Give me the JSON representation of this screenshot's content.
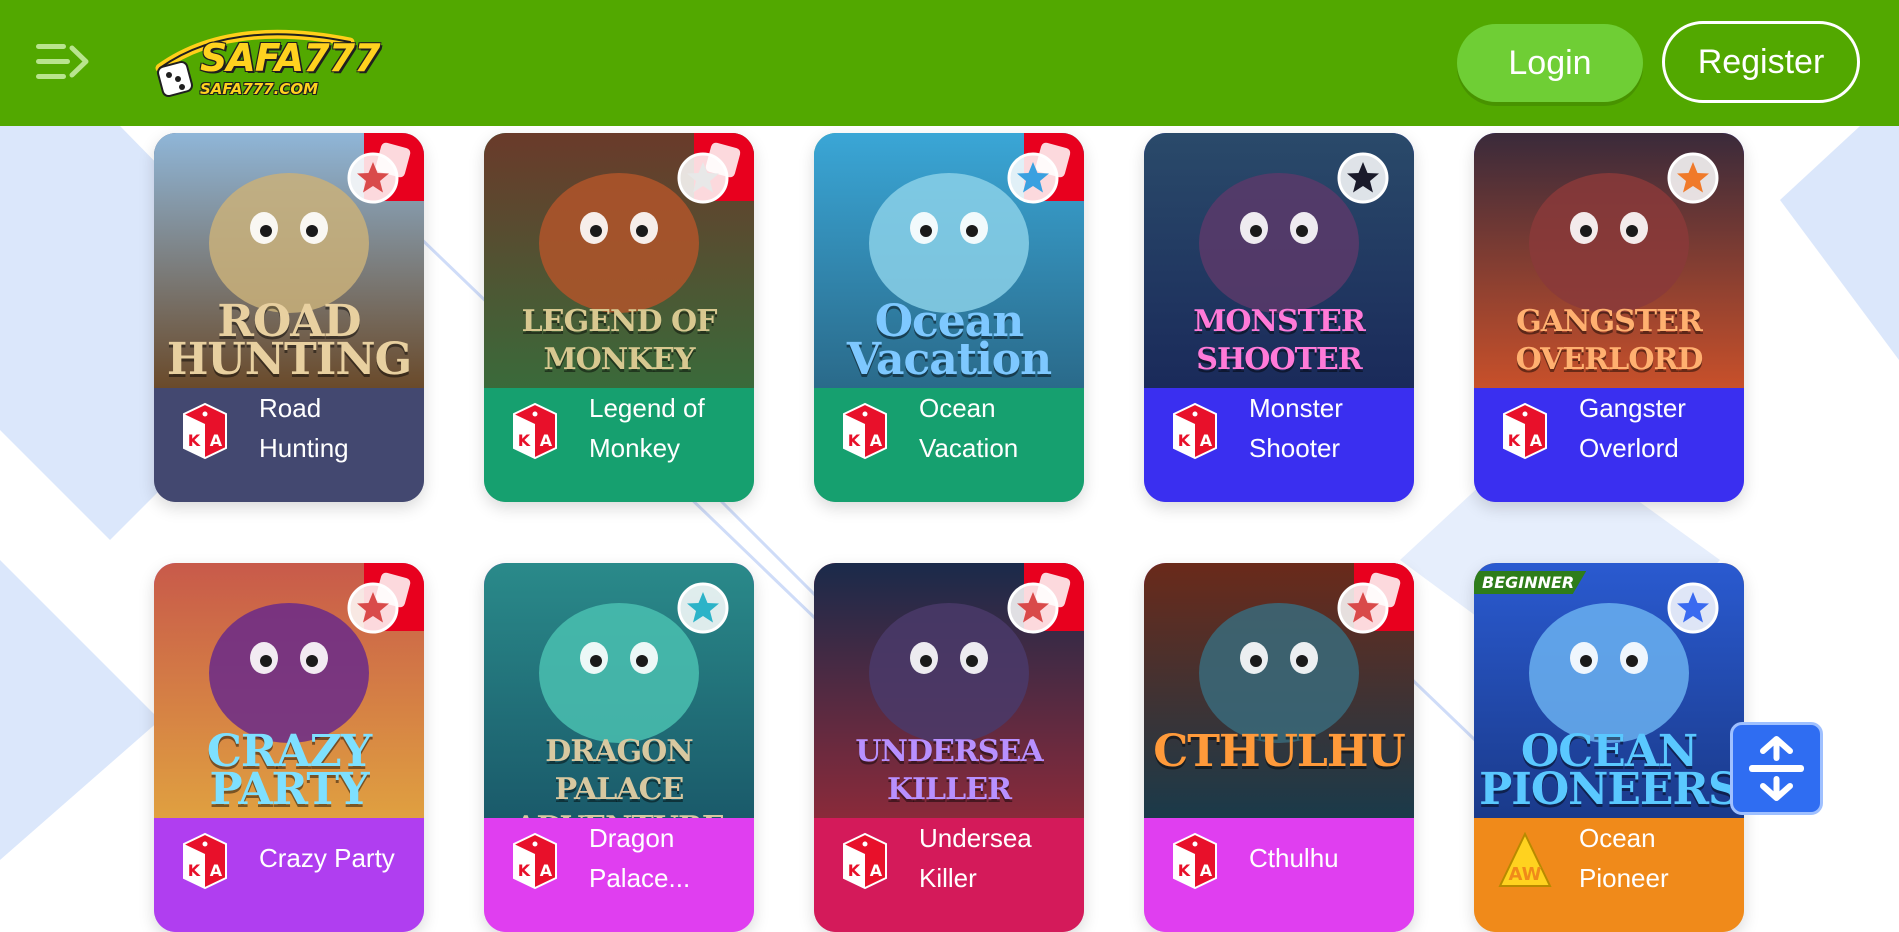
{
  "header": {
    "logo_title": "SAFA777",
    "logo_sub": "SAFA777.COM",
    "login_label": "Login",
    "register_label": "Register"
  },
  "colors": {
    "header_bg": "#52a800",
    "login_bg": "#6fce35",
    "ka_ribbon": "#e8001e",
    "fab": "#2f6df2"
  },
  "games": [
    {
      "name": "Road Hunting",
      "thumb_text": "ROAD\nHUNTING",
      "provider": "KA",
      "band": "#434870",
      "fav_ring": "#d94a4a",
      "ka_ribbon": true
    },
    {
      "name": "Legend of Monkey",
      "thumb_text": "LEGEND OF\nMONKEY",
      "provider": "KA",
      "band": "#16a06f",
      "fav_ring": "#e8e8e8",
      "ka_ribbon": true
    },
    {
      "name": "Ocean Vacation",
      "thumb_text": "Ocean\nVacation",
      "provider": "KA",
      "band": "#16a06f",
      "fav_ring": "#3aa0e0",
      "ka_ribbon": true
    },
    {
      "name": "Monster Shooter",
      "thumb_text": "MONSTER\nSHOOTER",
      "provider": "KA",
      "band": "#3a2ff0",
      "fav_ring": "#1a1a2a",
      "ka_ribbon": false
    },
    {
      "name": "Gangster Overlord",
      "thumb_text": "GANGSTER\nOVERLORD",
      "provider": "KA",
      "band": "#3a2ff0",
      "fav_ring": "#f07a2a",
      "ka_ribbon": false
    },
    {
      "name": "Crazy Party",
      "thumb_text": "CRAZY\nPARTY",
      "provider": "KA",
      "band": "#b03ef0",
      "fav_ring": "#d94a4a",
      "ka_ribbon": true
    },
    {
      "name": "Dragon Palace...",
      "thumb_text": "DRAGON PALACE\nADVENTURE",
      "provider": "KA",
      "band": "#e03ef0",
      "fav_ring": "#2cb3c8",
      "ka_ribbon": false
    },
    {
      "name": "Undersea Killer",
      "thumb_text": "UNDERSEA\nKILLER",
      "provider": "KA",
      "band": "#d41a5a",
      "fav_ring": "#d94a4a",
      "ka_ribbon": true
    },
    {
      "name": "Cthulhu",
      "thumb_text": "CTHULHU",
      "provider": "KA",
      "band": "#e03ef0",
      "fav_ring": "#d94a4a",
      "ka_ribbon": true
    },
    {
      "name": "Ocean Pioneer",
      "thumb_text": "OCEAN\nPIONEERS",
      "provider": "AW",
      "band": "#f08a1a",
      "fav_ring": "#3a6af0",
      "ka_ribbon": false,
      "badge": "BEGINNER"
    }
  ],
  "game_names_split": [
    [
      "Road",
      "Hunting"
    ],
    [
      "Legend of",
      "Monkey"
    ],
    [
      "Ocean",
      "Vacation"
    ],
    [
      "Monster",
      "Shooter"
    ],
    [
      "Gangster",
      "Overlord"
    ],
    [
      "Crazy Party"
    ],
    [
      "Dragon",
      "Palace..."
    ],
    [
      "Undersea",
      "Killer"
    ],
    [
      "Cthulhu"
    ],
    [
      "Ocean",
      "Pioneer"
    ]
  ],
  "icons": {
    "menu": "menu-arrow-icon",
    "favorite": "star-icon",
    "provider": "dice-icon",
    "scroll": "expand-collapse-icon"
  }
}
